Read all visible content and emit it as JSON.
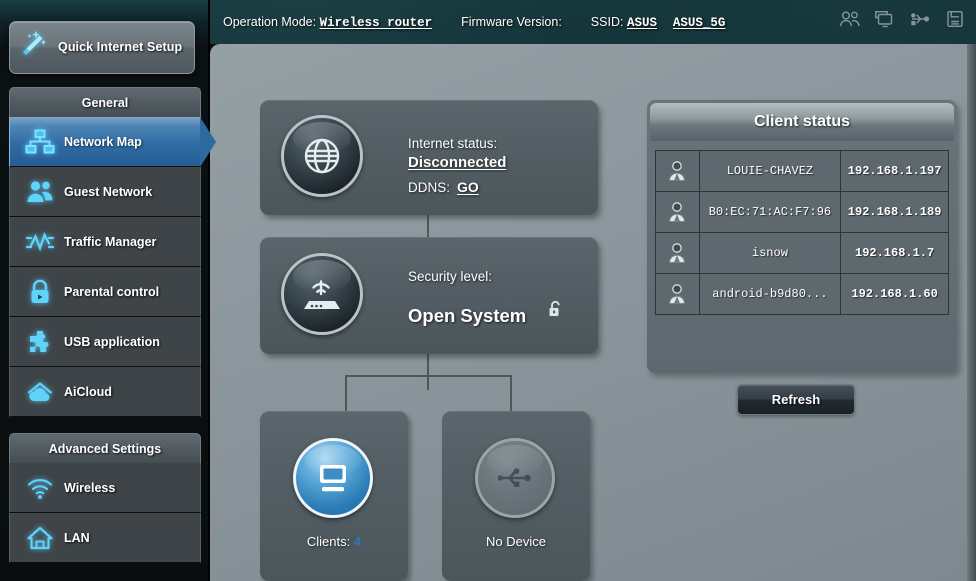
{
  "header": {
    "operation_mode_label": "Operation Mode:",
    "operation_mode_value": "Wireless router",
    "firmware_label": "Firmware Version:",
    "firmware_value": "",
    "ssid_label": "SSID:",
    "ssid_1": "ASUS",
    "ssid_2": "ASUS_5G",
    "icons": [
      "clients-icon",
      "network-monitor-icon",
      "usb-icon",
      "printer-icon"
    ]
  },
  "sidebar": {
    "quick_setup_label": "Quick Internet Setup",
    "quick_setup_icon": "magic-wand-icon",
    "general_header": "General",
    "general_items": [
      {
        "label": "Network Map",
        "icon": "network-map-icon",
        "active": true
      },
      {
        "label": "Guest Network",
        "icon": "guest-network-icon",
        "active": false
      },
      {
        "label": "Traffic Manager",
        "icon": "traffic-manager-icon",
        "active": false
      },
      {
        "label": "Parental control",
        "icon": "parental-control-icon",
        "active": false
      },
      {
        "label": "USB application",
        "icon": "usb-application-icon",
        "active": false
      },
      {
        "label": "AiCloud",
        "icon": "aicloud-icon",
        "active": false
      }
    ],
    "advanced_header": "Advanced Settings",
    "advanced_items": [
      {
        "label": "Wireless",
        "icon": "wireless-icon"
      },
      {
        "label": "LAN",
        "icon": "lan-home-icon"
      }
    ]
  },
  "network_map": {
    "internet": {
      "icon": "globe-icon",
      "status_label": "Internet status:",
      "status_value": "Disconnected",
      "ddns_label": "DDNS:",
      "ddns_action": "GO"
    },
    "router": {
      "icon": "router-icon",
      "security_label": "Security level:",
      "security_value": "Open System",
      "lock_icon": "unlocked-padlock-icon"
    },
    "clients_node": {
      "icon": "monitor-icon",
      "caption_label": "Clients:",
      "caption_value": "4"
    },
    "usb_node": {
      "icon": "usb-icon",
      "caption_label": "No Device"
    }
  },
  "client_status": {
    "title": "Client status",
    "rows": [
      {
        "icon": "user-icon",
        "name": "LOUIE-CHAVEZ",
        "ip": "192.168.1.197"
      },
      {
        "icon": "user-icon",
        "name": "B0:EC:71:AC:F7:96",
        "ip": "192.168.1.189"
      },
      {
        "icon": "user-icon",
        "name": "isnow",
        "ip": "192.168.1.7"
      },
      {
        "icon": "user-icon",
        "name": "android-b9d80...",
        "ip": "192.168.1.60"
      }
    ],
    "refresh_label": "Refresh"
  },
  "colors": {
    "accent_blue": "#2f76b5",
    "icon_cyan": "#5fd3f8",
    "content_bg": "#8e999f",
    "card_bg": "#525d63"
  }
}
